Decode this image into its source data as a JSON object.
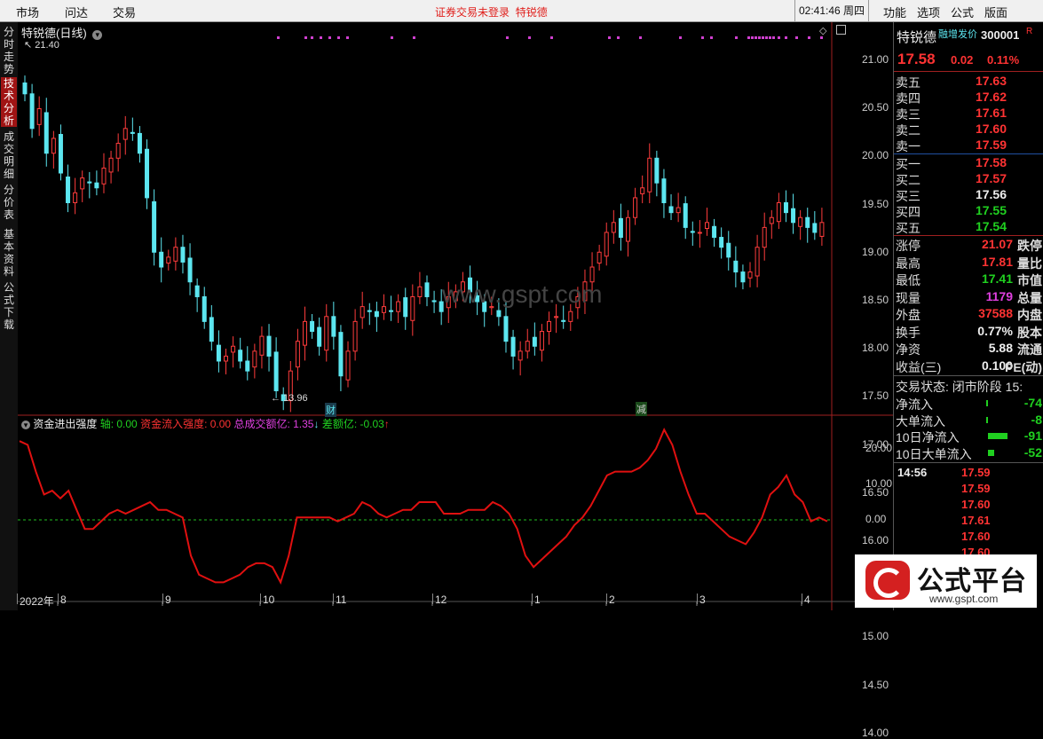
{
  "menu": {
    "market": "市场",
    "wenda": "问达",
    "trade": "交易",
    "function": "功能",
    "options": "选项",
    "formula": "公式",
    "layout": "版面"
  },
  "status": {
    "login_text": "证券交易未登录",
    "stock_name": "特锐德",
    "clock": "02:41:46 周四"
  },
  "vtabs": [
    "分时走势",
    "技术分析",
    "成交明细",
    "分价表",
    "基本资料",
    "公式下载"
  ],
  "chart": {
    "title": "特锐德(日线)",
    "y_ticks": [
      "21.00",
      "20.50",
      "20.00",
      "19.50",
      "19.00",
      "18.50",
      "18.00",
      "17.50",
      "17.00",
      "16.50",
      "16.00",
      "15.50",
      "15.00",
      "14.50",
      "14.00"
    ],
    "high_label": "21.40",
    "low_label": "13.96",
    "marker_cai": "财",
    "marker_jian": "减",
    "watermark": "www.gspt.com",
    "indicator": {
      "name": "资金进出强度",
      "axis_label": "轴: 0.00",
      "inflow_label": "资金流入强度: 0.00",
      "total_label": "总成交额亿: 1.35",
      "diff_label": "差额亿: -0.03",
      "y_ticks": [
        "20.00",
        "10.00",
        "0.00"
      ]
    },
    "x_labels": [
      "2022年",
      "8",
      "9",
      "10",
      "11",
      "12",
      "1",
      "2",
      "3",
      "4"
    ],
    "colors": {
      "up": "#ff3c3c",
      "down": "#5ce6f0",
      "flow": "#e01010",
      "zero": "#20c020"
    }
  },
  "chart_data": {
    "type": "line",
    "title": "资金进出强度",
    "series": [
      {
        "name": "资金流入强度",
        "values": [
          20,
          19,
          12,
          6,
          7,
          5,
          7,
          2,
          -3,
          -3,
          -1,
          1,
          2,
          1,
          2,
          3,
          4,
          2,
          2,
          1,
          0,
          -10,
          -15,
          -16,
          -17,
          -17,
          -16,
          -15,
          -13,
          -12,
          -12,
          -13,
          -17,
          -10,
          0,
          0,
          0,
          0,
          0,
          -1,
          0,
          1,
          4,
          3,
          1,
          0,
          1,
          2,
          2,
          4,
          4,
          4,
          1,
          1,
          1,
          2,
          2,
          2,
          4,
          3,
          1,
          -3,
          -10,
          -13,
          -11,
          -9,
          -7,
          -5,
          -2,
          0,
          3,
          7,
          11,
          12,
          12,
          12,
          13,
          15,
          18,
          23,
          19,
          12,
          6,
          1,
          1,
          -1,
          -3,
          -5,
          -6,
          -7,
          -4,
          0,
          6,
          8,
          11,
          6,
          4,
          -1,
          0,
          -1
        ]
      }
    ],
    "ylim": [
      -19,
      24
    ]
  },
  "quote": {
    "name": "特锐德",
    "badge": "融增发价",
    "code": "300001",
    "flag": "R",
    "price": "17.58",
    "change": "0.02",
    "change_pct": "0.11%",
    "sell": [
      {
        "label": "卖五",
        "price": "17.63"
      },
      {
        "label": "卖四",
        "price": "17.62"
      },
      {
        "label": "卖三",
        "price": "17.61"
      },
      {
        "label": "卖二",
        "price": "17.60"
      },
      {
        "label": "卖一",
        "price": "17.59"
      }
    ],
    "buy": [
      {
        "label": "买一",
        "price": "17.58"
      },
      {
        "label": "买二",
        "price": "17.57"
      },
      {
        "label": "买三",
        "price": "17.56"
      },
      {
        "label": "买四",
        "price": "17.55"
      },
      {
        "label": "买五",
        "price": "17.54"
      }
    ],
    "stats": [
      {
        "label": "涨停",
        "value": "21.07",
        "right": "跌停"
      },
      {
        "label": "最高",
        "value": "17.81",
        "right": "量比"
      },
      {
        "label": "最低",
        "value": "17.41",
        "right": "市值"
      },
      {
        "label": "现量",
        "value": "1179",
        "right": "总量"
      },
      {
        "label": "外盘",
        "value": "37588",
        "right": "内盘"
      },
      {
        "label": "换手",
        "value": "0.77%",
        "right": "股本"
      },
      {
        "label": "净资",
        "value": "5.88",
        "right": "流通"
      },
      {
        "label": "收益(三)",
        "value": "0.100",
        "right": "PE(动)"
      }
    ],
    "trade_status": "交易状态: 闭市阶段",
    "trade_time": "15:",
    "flows": [
      {
        "label": "净流入",
        "value": "-74"
      },
      {
        "label": "大单流入",
        "value": "-8"
      },
      {
        "label": "10日净流入",
        "value": "-91"
      },
      {
        "label": "10日大单流入",
        "value": "-52"
      }
    ],
    "ticks_time": "14:56",
    "ticks": [
      "17.59",
      "17.59",
      "17.60",
      "17.61",
      "17.60",
      "17.60"
    ]
  },
  "logo": {
    "text": "公式平台",
    "url": "www.gspt.com"
  }
}
